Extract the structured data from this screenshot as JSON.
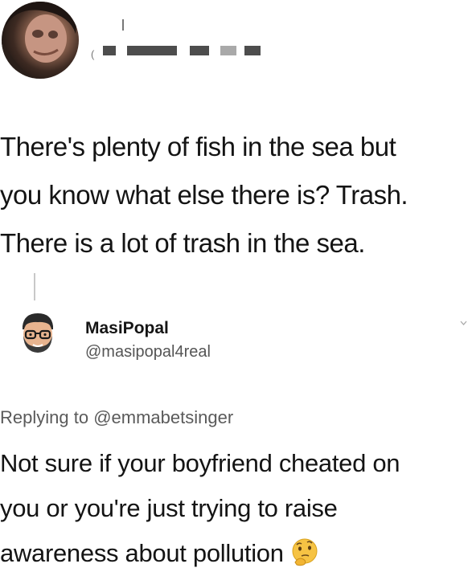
{
  "original_tweet": {
    "lines": [
      "There's plenty of fish in the sea but",
      "you know what else there is? Trash.",
      "There is a lot of trash in the sea."
    ],
    "paren": "("
  },
  "reply": {
    "display_name": "MasiPopal",
    "handle": "@masipopal4real",
    "replying_prefix": "Replying to",
    "replying_mention": "@emmabetsinger",
    "lines": [
      "Not sure if your boyfriend cheated on",
      "you or you're just trying to raise",
      "awareness about pollution"
    ],
    "emoji": "thinking-face"
  },
  "colors": {
    "text": "#141414",
    "secondary": "#5a5a5a",
    "thread_line": "#c8c8c8",
    "redaction": "#4d4d4d"
  }
}
